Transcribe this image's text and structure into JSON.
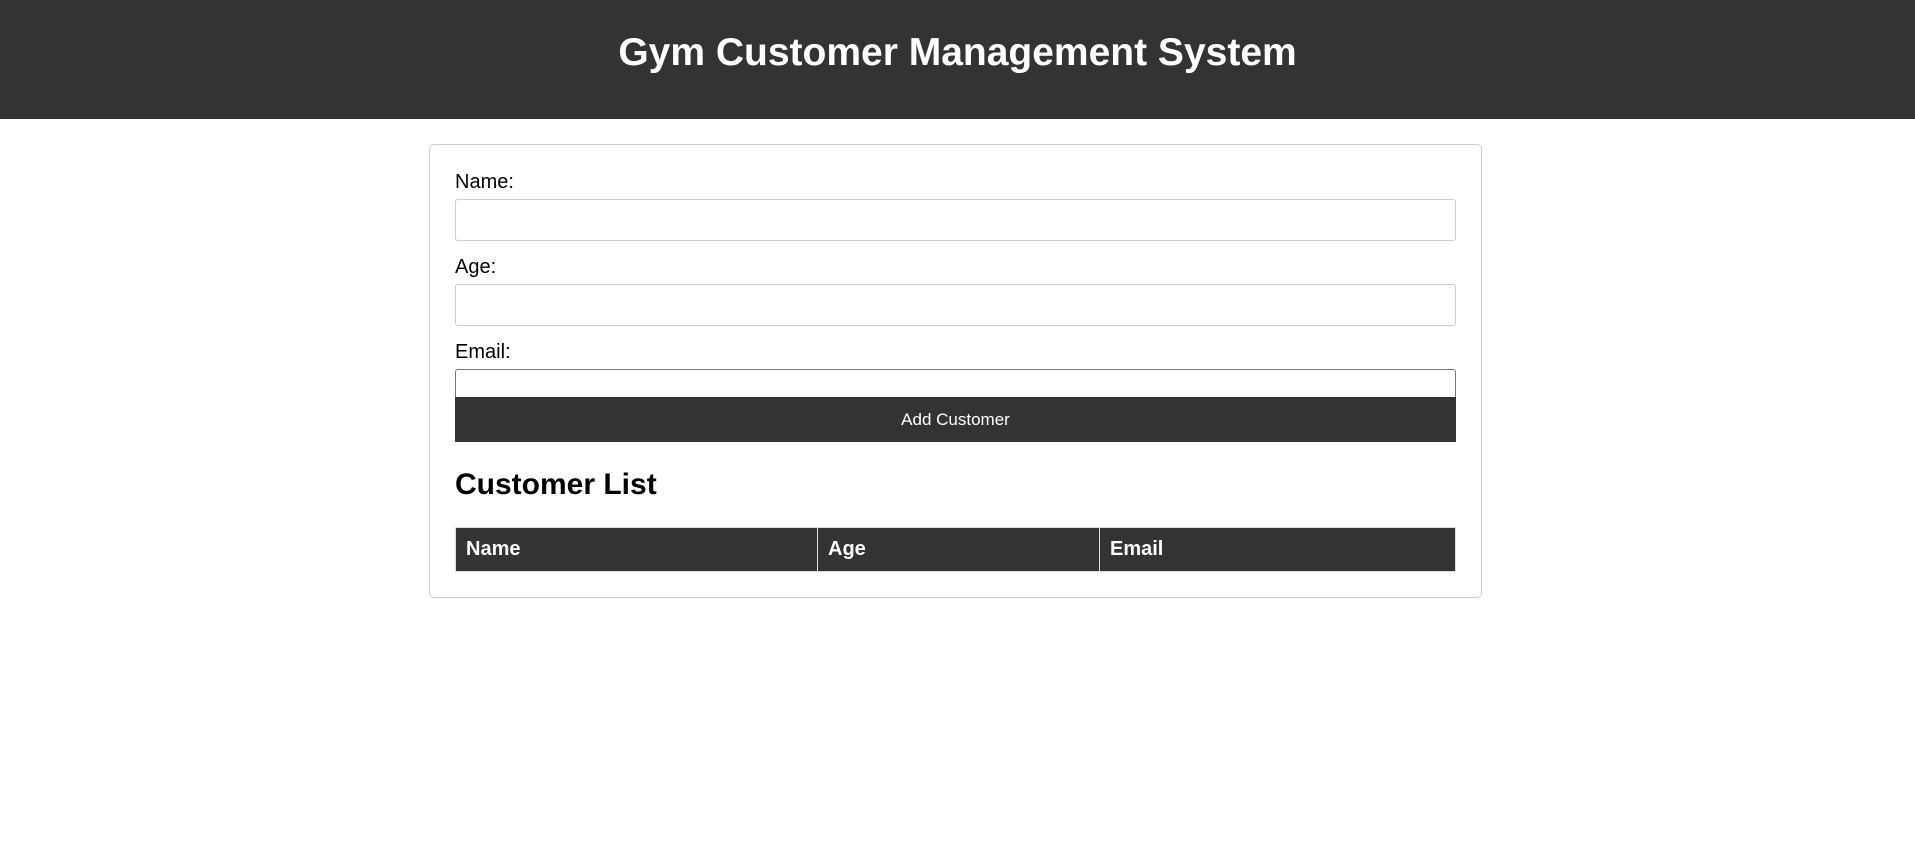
{
  "header": {
    "title": "Gym Customer Management System"
  },
  "form": {
    "name_label": "Name:",
    "name_value": "",
    "age_label": "Age:",
    "age_value": "",
    "email_label": "Email:",
    "email_value": "",
    "submit_label": "Add Customer"
  },
  "customer_list": {
    "title": "Customer List",
    "columns": [
      "Name",
      "Age",
      "Email"
    ],
    "rows": []
  },
  "colors": {
    "header_bg": "#333333",
    "header_text": "#ffffff",
    "button_bg": "#333333",
    "border": "#cccccc"
  }
}
